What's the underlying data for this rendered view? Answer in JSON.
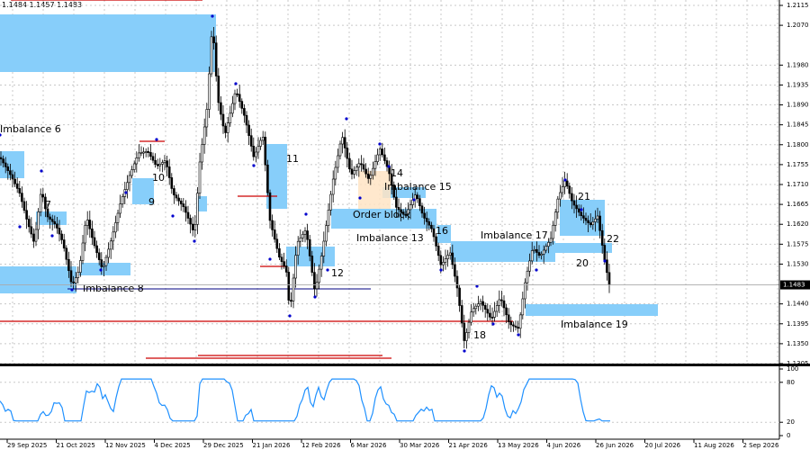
{
  "header": {
    "ohlc_text": "1.1484 1.1457 1.1483"
  },
  "chart_data": {
    "type": "candlestick",
    "y_range": [
      1.1305,
      1.2115
    ],
    "oscillator_range": [
      0,
      100
    ],
    "price_ticks": [
      "1.2115",
      "1.2070",
      "1.1980",
      "1.1935",
      "1.1890",
      "1.1845",
      "1.1800",
      "1.1755",
      "1.1710",
      "1.1665",
      "1.1620",
      "1.1575",
      "1.1530",
      "1.1440",
      "1.1395",
      "1.1350",
      "1.1305"
    ],
    "current_price": "1.1483",
    "oscillator_ticks": [
      "100",
      "80",
      "20",
      "0"
    ],
    "date_ticks": [
      "29 Sep 2025",
      "21 Oct 2025",
      "12 Nov 2025",
      "4 Dec 2025",
      "29 Dec 2025",
      "21 Jan 2026",
      "12 Feb 2026",
      "6 Mar 2026",
      "30 Mar 2026",
      "21 Apr 2026",
      "13 May 2026",
      "4 Jun 2026",
      "26 Jun 2026",
      "20 Jul 2026",
      "11 Aug 2026",
      "2 Sep 2026"
    ],
    "labels": [
      "Imbalance 6",
      "7",
      "Imbalance 8",
      "9",
      "10",
      "11",
      "12",
      "Order block",
      "Imbalance 13",
      "14",
      "Imbalance 15",
      "16",
      "Imbalance 17",
      "18",
      "Imbalance 19",
      "20",
      "21",
      "22"
    ],
    "colors": {
      "zone": "#87CEFA",
      "order_block": "#FFE4C4",
      "red_line": "#CC0000",
      "blue_line": "#000080",
      "oscillator": "#1E90FF",
      "candle": "#000000",
      "marker": "#0000CD",
      "grid": "#C8C8C8"
    }
  }
}
